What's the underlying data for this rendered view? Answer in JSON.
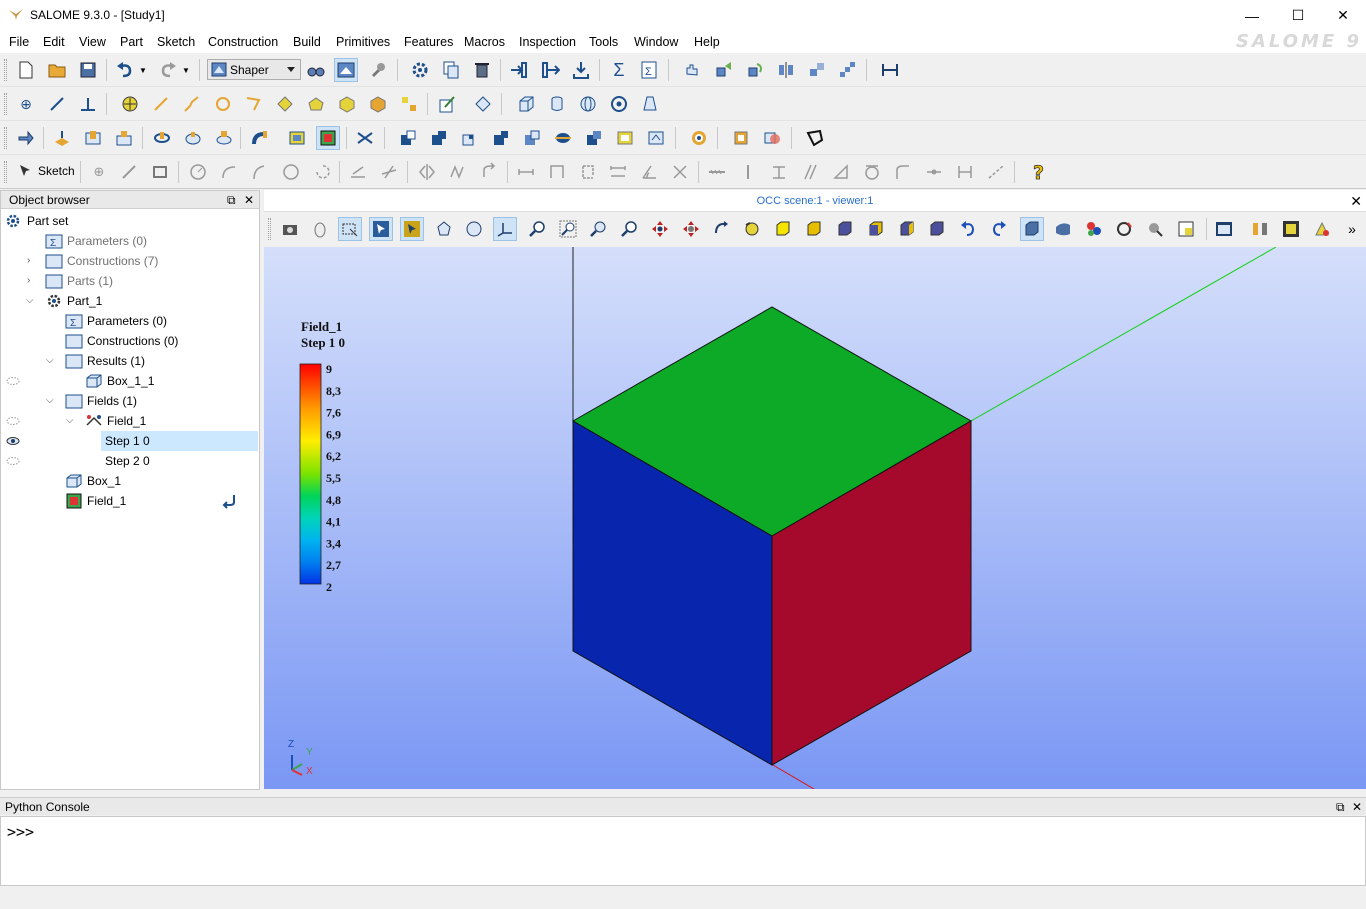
{
  "window": {
    "title": "SALOME 9.3.0 - [Study1]",
    "minimize": "—",
    "maximize": "☐",
    "close": "✕"
  },
  "menu": {
    "items": [
      "File",
      "Edit",
      "View",
      "Part",
      "Sketch",
      "Construction",
      "Build",
      "Primitives",
      "Features",
      "Macros",
      "Inspection",
      "Tools",
      "Window",
      "Help"
    ]
  },
  "brand": "SALOME 9",
  "toolbar": {
    "module_combo": "Shaper",
    "sketch_label": "Sketch"
  },
  "object_browser": {
    "title": "Object browser",
    "float_btn": "⧉",
    "close_btn": "✕",
    "items": [
      {
        "label": "Part set",
        "depth": 0,
        "icon": "gear-icon",
        "gray": false
      },
      {
        "label": "Parameters (0)",
        "depth": 2,
        "icon": "folder-parameters-icon",
        "gray": true
      },
      {
        "label": "Constructions (7)",
        "depth": 2,
        "icon": "folder-icon",
        "gray": true
      },
      {
        "label": "Parts (1)",
        "depth": 2,
        "icon": "folder-icon",
        "gray": true
      },
      {
        "label": "Part_1",
        "depth": 2,
        "icon": "part-gear-icon",
        "gray": false
      },
      {
        "label": "Parameters (0)",
        "depth": 3,
        "icon": "folder-parameters-icon",
        "gray": false
      },
      {
        "label": "Constructions (0)",
        "depth": 3,
        "icon": "folder-icon",
        "gray": false
      },
      {
        "label": "Results (1)",
        "depth": 3,
        "icon": "folder-icon",
        "gray": false
      },
      {
        "label": "Box_1_1",
        "depth": 4,
        "icon": "box-result-icon",
        "gray": false
      },
      {
        "label": "Fields (1)",
        "depth": 3,
        "icon": "folder-icon",
        "gray": false
      },
      {
        "label": "Field_1",
        "depth": 4,
        "icon": "field-icon",
        "gray": false
      },
      {
        "label": "Step 1 0",
        "depth": 5,
        "icon": "",
        "gray": false
      },
      {
        "label": "Step 2 0",
        "depth": 5,
        "icon": "",
        "gray": false
      },
      {
        "label": "Box_1",
        "depth": 3,
        "icon": "box-feature-icon",
        "gray": false
      },
      {
        "label": "Field_1",
        "depth": 3,
        "icon": "field-feature-icon",
        "gray": false
      }
    ]
  },
  "viewer": {
    "title": "OCC scene:1 - viewer:1",
    "close_btn": "✕",
    "more_btn": "»",
    "legend": {
      "title_line1": "Field_1",
      "title_line2": "Step 1 0",
      "values": [
        "9",
        "8,3",
        "7,6",
        "6,9",
        "6,2",
        "5,5",
        "4,8",
        "4,1",
        "3,4",
        "2,7",
        "2"
      ]
    },
    "cube_colors": {
      "top": "#0caa26",
      "left": "#0725ad",
      "right": "#a50a2c"
    },
    "triad": {
      "z": "Z",
      "y": "Y",
      "x": "X"
    }
  },
  "python_console": {
    "title": "Python Console",
    "float_btn": "⧉",
    "close_btn": "✕",
    "prompt": ">>>"
  }
}
